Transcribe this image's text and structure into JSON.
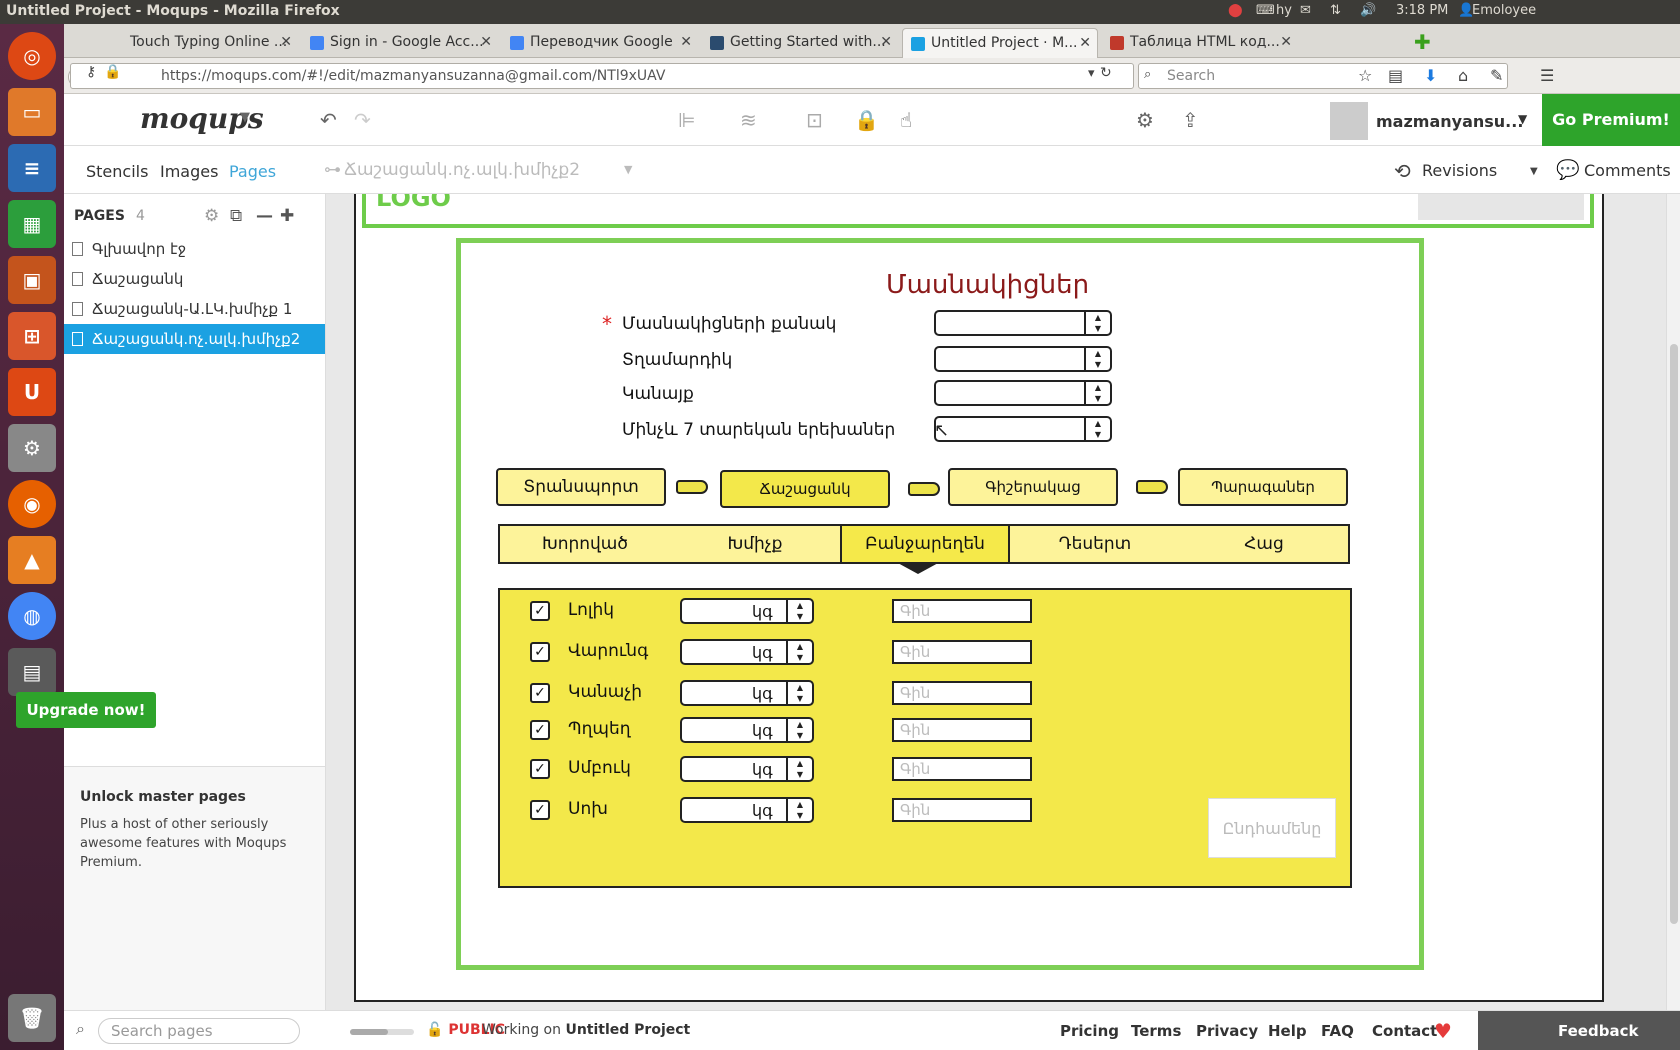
{
  "os_panel": {
    "window_title": "Untitled Project - Moqups - Mozilla Firefox",
    "keyboard": "hy",
    "time": "3:18 PM",
    "user": "Emoloyee"
  },
  "browser": {
    "tabs": [
      {
        "label": "Touch Typing Online ...",
        "favicon_color": "#d9d9d9"
      },
      {
        "label": "Sign in - Google Acc...",
        "favicon_color": "#4285f4"
      },
      {
        "label": "Переводчик Google",
        "favicon_color": "#4285f4"
      },
      {
        "label": "Getting Started with...",
        "favicon_color": "#2b4b6e"
      },
      {
        "label": "Untitled Project · M...",
        "favicon_color": "#1ba1e2"
      },
      {
        "label": "Таблица HTML код...",
        "favicon_color": "#c0392b"
      }
    ],
    "url": "https://moqups.com/#!/edit/mazmanyansuzanna@gmail.com/NTl9xUAV",
    "search_placeholder": "Search"
  },
  "app": {
    "logo": "moqups",
    "user_name": "mazmanyansu...",
    "go_premium": "Go Premium!",
    "sub_tabs": [
      "Stencils",
      "Images",
      "Pages"
    ],
    "active_sub_tab": "Pages",
    "current_page": "Ճաշացանկ.ոչ.ալկ.խմիչք2",
    "revisions": "Revisions",
    "comments": "Comments"
  },
  "sidebar": {
    "heading": "PAGES",
    "count": "4",
    "pages": [
      "Գլխավոր էջ",
      "Ճաշացանկ",
      "Ճաշացանկ-Ա.ԼԿ.խմիչք 1",
      "Ճաշացանկ.ոչ.ալկ.խմիչք2"
    ],
    "active_page_index": 3,
    "unlock_title": "Unlock master pages",
    "unlock_text": "Plus a host of other seriously awesome features with Moqups Premium.",
    "upgrade_label": "Upgrade now!"
  },
  "mockup": {
    "logo_text": "LOGO",
    "title": "Մասնակիցներ",
    "required_mark": "*",
    "fields": [
      "Մասնակիցների քանակ",
      "Տղամարդիկ",
      "Կանայք",
      "Մինչև 7 տարեկան երեխաներ"
    ],
    "steps": [
      "Տրանսպորտ",
      "Ճաշացանկ",
      "Գիշերակաց",
      "Պարագաներ"
    ],
    "category_tabs": [
      "Խորոված",
      "Խմիչք",
      "Բանջարեղեն",
      "Դեսերտ",
      "Հաց"
    ],
    "active_category": "Բանջարեղեն",
    "items": [
      {
        "name": "Լոլիկ",
        "checked": true,
        "unit": "կգ",
        "price_placeholder": "Գին"
      },
      {
        "name": "Վարունգ",
        "checked": true,
        "unit": "կգ",
        "price_placeholder": "Գին"
      },
      {
        "name": "Կանաչի",
        "checked": true,
        "unit": "կգ",
        "price_placeholder": "Գին"
      },
      {
        "name": "Պղպեղ",
        "checked": true,
        "unit": "կգ",
        "price_placeholder": "Գին"
      },
      {
        "name": "Սմբուկ",
        "checked": true,
        "unit": "կգ",
        "price_placeholder": "Գին"
      },
      {
        "name": "Սոխ",
        "checked": true,
        "unit": "կգ",
        "price_placeholder": "Գին"
      }
    ],
    "total_label": "Ընդհամենը"
  },
  "footer": {
    "search_placeholder": "Search pages",
    "public_label": "PUBLIC",
    "working_on": "Working on",
    "project_name": "Untitled Project",
    "links": [
      "Pricing",
      "Terms",
      "Privacy",
      "Help",
      "FAQ",
      "Contact"
    ],
    "feedback": "Feedback"
  },
  "colors": {
    "accent_blue": "#1ba1e2",
    "premium_green": "#2ea42b",
    "mock_green": "#7ecf56",
    "mock_yellow": "#f3e84a",
    "title_red": "#8b1a1a"
  }
}
